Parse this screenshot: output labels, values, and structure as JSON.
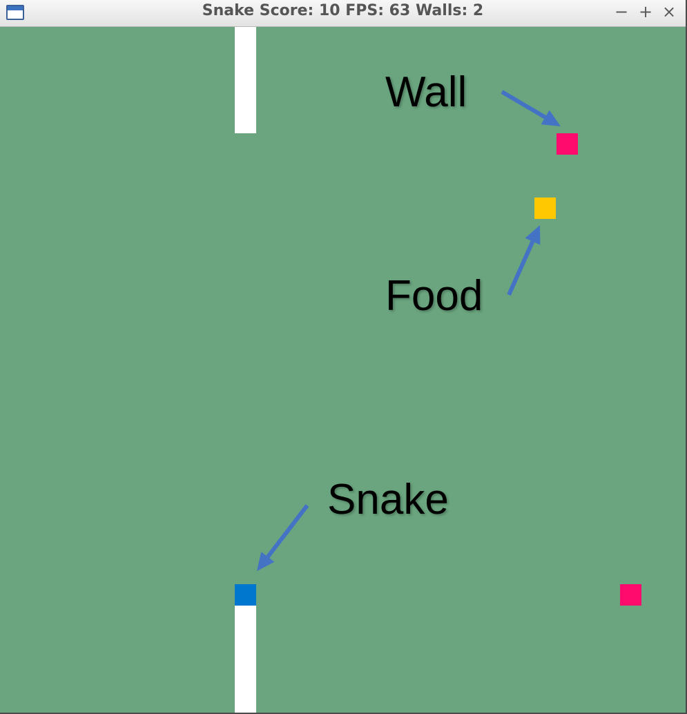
{
  "window": {
    "title": "Snake Score: 10 FPS: 63 Walls: 2",
    "controls": {
      "minimize": "−",
      "maximize": "+",
      "close": "×"
    }
  },
  "game": {
    "score": 10,
    "fps": 63,
    "walls": 2,
    "colors": {
      "background": "#6aa57f",
      "snake_head": "#0077cf",
      "snake_body": "#ffffff",
      "food": "#ffc800",
      "wall": "#ff0b6d"
    }
  },
  "annotations": {
    "wall_label": "Wall",
    "food_label": "Food",
    "snake_label": "Snake",
    "arrow_color": "#4472c4"
  }
}
